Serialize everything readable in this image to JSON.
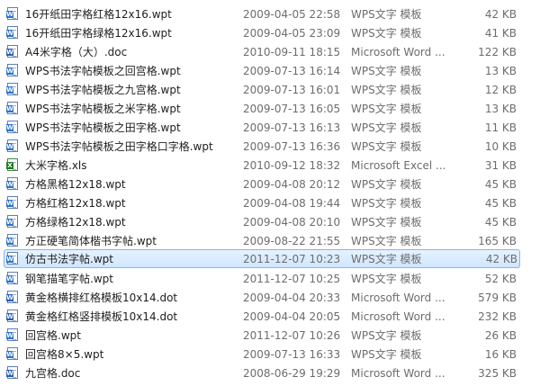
{
  "files": [
    {
      "name": "16开纸田字格红格12x16.wpt",
      "date": "2009-04-05 22:58",
      "type": "WPS文字 模板",
      "size": "42 KB",
      "icon": "wps"
    },
    {
      "name": "16开纸田字格绿格12x16.wpt",
      "date": "2009-04-05 23:09",
      "type": "WPS文字 模板",
      "size": "41 KB",
      "icon": "wps"
    },
    {
      "name": "A4米字格（大）.doc",
      "date": "2010-09-11 18:15",
      "type": "Microsoft Word ...",
      "size": "122 KB",
      "icon": "word"
    },
    {
      "name": "WPS书法字帖模板之回宫格.wpt",
      "date": "2009-07-13 16:14",
      "type": "WPS文字 模板",
      "size": "13 KB",
      "icon": "wps"
    },
    {
      "name": "WPS书法字帖模板之九宫格.wpt",
      "date": "2009-07-13 16:01",
      "type": "WPS文字 模板",
      "size": "12 KB",
      "icon": "wps"
    },
    {
      "name": "WPS书法字帖模板之米字格.wpt",
      "date": "2009-07-13 16:05",
      "type": "WPS文字 模板",
      "size": "13 KB",
      "icon": "wps"
    },
    {
      "name": "WPS书法字帖模板之田字格.wpt",
      "date": "2009-07-13 16:13",
      "type": "WPS文字 模板",
      "size": "11 KB",
      "icon": "wps"
    },
    {
      "name": "WPS书法字帖模板之田字格口字格.wpt",
      "date": "2009-07-13 16:36",
      "type": "WPS文字 模板",
      "size": "10 KB",
      "icon": "wps"
    },
    {
      "name": "大米字格.xls",
      "date": "2010-09-12 18:32",
      "type": "Microsoft Excel ...",
      "size": "31 KB",
      "icon": "excel"
    },
    {
      "name": "方格黑格12x18.wpt",
      "date": "2009-04-08 20:12",
      "type": "WPS文字 模板",
      "size": "45 KB",
      "icon": "wps"
    },
    {
      "name": "方格红格12x18.wpt",
      "date": "2009-04-08 19:44",
      "type": "WPS文字 模板",
      "size": "45 KB",
      "icon": "wps"
    },
    {
      "name": "方格绿格12x18.wpt",
      "date": "2009-04-08 20:10",
      "type": "WPS文字 模板",
      "size": "45 KB",
      "icon": "wps"
    },
    {
      "name": "方正硬笔简体楷书字帖.wpt",
      "date": "2009-08-22 21:55",
      "type": "WPS文字 模板",
      "size": "165 KB",
      "icon": "wps"
    },
    {
      "name": "仿古书法字帖.wpt",
      "date": "2011-12-07 10:23",
      "type": "WPS文字 模板",
      "size": "42 KB",
      "icon": "wps",
      "selected": true
    },
    {
      "name": "钢笔描笔字帖.wpt",
      "date": "2011-12-07 10:25",
      "type": "WPS文字 模板",
      "size": "52 KB",
      "icon": "wps"
    },
    {
      "name": "黄金格横排红格模板10x14.dot",
      "date": "2009-04-04 20:33",
      "type": "Microsoft Word ...",
      "size": "579 KB",
      "icon": "word"
    },
    {
      "name": "黄金格红格竖排模板10x14.dot",
      "date": "2009-04-04 20:05",
      "type": "Microsoft Word ...",
      "size": "232 KB",
      "icon": "word"
    },
    {
      "name": "回宫格.wpt",
      "date": "2011-12-07 10:26",
      "type": "WPS文字 模板",
      "size": "26 KB",
      "icon": "wps"
    },
    {
      "name": "回宫格8×5.wpt",
      "date": "2009-07-13 16:33",
      "type": "WPS文字 模板",
      "size": "16 KB",
      "icon": "wps"
    },
    {
      "name": "九宫格.doc",
      "date": "2008-06-29 19:29",
      "type": "Microsoft Word ...",
      "size": "325 KB",
      "icon": "word"
    }
  ]
}
